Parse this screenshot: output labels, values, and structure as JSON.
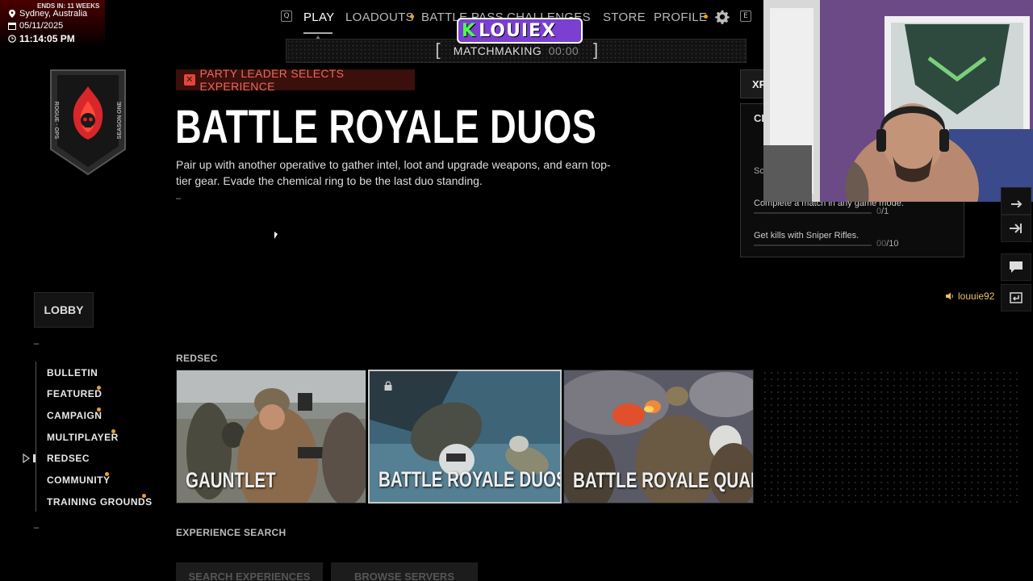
{
  "stream": {
    "ends_in": "ENDS IN: 11 WEEKS",
    "location": "Sydney, Australia",
    "date": "05/11/2025",
    "time": "11:14:05 PM"
  },
  "nav": {
    "key_left": "Q",
    "items": [
      "PLAY",
      "LOADOUTS",
      "BATTLE PASS",
      "CHALLENGES",
      "STORE",
      "PROFILE"
    ],
    "key_right": "E"
  },
  "matchmaking": {
    "label": "MATCHMAKING",
    "timer": "00:00"
  },
  "streamer_logo": {
    "initial": "K",
    "name": "LOUIEX"
  },
  "badge": {
    "text_left": "ROGUE · OPS",
    "text_right": "SEASON ONE"
  },
  "mode": {
    "party_notice": "PARTY LEADER SELECTS EXPERIENCE",
    "title": "BATTLE ROYALE DUOS",
    "description": "Pair up with another operative to gather intel, loot and upgrade weapons, and earn top-tier gear. Evade the chemical ring to be the last duo standing.",
    "dash": "–"
  },
  "challenges": {
    "xp_tab": "XP",
    "header": "CH",
    "sub": "Sc",
    "items": [
      {
        "label": "Complete a match in any game mode.",
        "current": "0",
        "total": "/1",
        "progress": 0
      },
      {
        "label": "Get kills with Sniper Rifles.",
        "current": "00",
        "total": "/10",
        "progress": 0
      }
    ]
  },
  "user": {
    "name": "louuie92"
  },
  "sidebar": {
    "lobby": "LOBBY",
    "dash": "–",
    "items": [
      {
        "label": "BULLETIN",
        "dot": false
      },
      {
        "label": "FEATURED",
        "dot": true
      },
      {
        "label": "CAMPAIGN",
        "dot": true
      },
      {
        "label": "MULTIPLAYER",
        "dot": true
      },
      {
        "label": "REDSEC",
        "dot": false,
        "active": true
      },
      {
        "label": "COMMUNITY",
        "dot": true
      },
      {
        "label": "TRAINING GROUNDS",
        "dot": true
      }
    ]
  },
  "sections": {
    "redsec": "REDSEC",
    "experience_search": "EXPERIENCE SEARCH"
  },
  "cards": [
    {
      "title": "GAUNTLET",
      "selected": false
    },
    {
      "title": "BATTLE ROYALE DUOS",
      "selected": true
    },
    {
      "title": "BATTLE ROYALE QUADS",
      "selected": false
    }
  ],
  "search_buttons": [
    "SEARCH EXPERIENCES",
    "BROWSE SERVERS"
  ],
  "colors": {
    "accent_orange": "#e8a22a",
    "party_red": "#e86a5c",
    "user_gold": "#e8c06a"
  }
}
